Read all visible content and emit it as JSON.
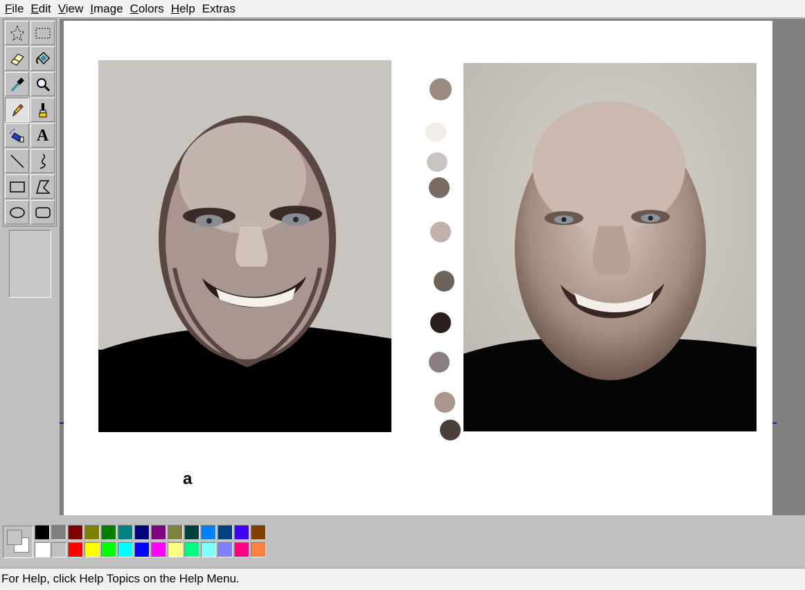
{
  "menu": {
    "items": [
      {
        "accel": "F",
        "rest": "ile"
      },
      {
        "accel": "E",
        "rest": "dit"
      },
      {
        "accel": "V",
        "rest": "iew"
      },
      {
        "accel": "I",
        "rest": "mage"
      },
      {
        "accel": "C",
        "rest": "olors"
      },
      {
        "accel": "H",
        "rest": "elp"
      },
      {
        "accel": "",
        "rest": "Extras"
      }
    ]
  },
  "tools": [
    {
      "name": "free-form-select",
      "icon": "star-select-icon"
    },
    {
      "name": "select",
      "icon": "rect-select-icon"
    },
    {
      "name": "eraser",
      "icon": "eraser-icon"
    },
    {
      "name": "fill",
      "icon": "paint-bucket-icon"
    },
    {
      "name": "pick-color",
      "icon": "eyedropper-icon"
    },
    {
      "name": "magnifier",
      "icon": "magnifier-icon"
    },
    {
      "name": "pencil",
      "icon": "pencil-icon",
      "active": true
    },
    {
      "name": "brush",
      "icon": "brush-icon"
    },
    {
      "name": "airbrush",
      "icon": "airbrush-icon"
    },
    {
      "name": "text",
      "icon": "text-icon"
    },
    {
      "name": "line",
      "icon": "line-icon"
    },
    {
      "name": "curve",
      "icon": "curve-icon"
    },
    {
      "name": "rectangle",
      "icon": "rectangle-icon"
    },
    {
      "name": "polygon",
      "icon": "polygon-icon"
    },
    {
      "name": "ellipse",
      "icon": "ellipse-icon"
    },
    {
      "name": "rounded-rectangle",
      "icon": "rounded-rectangle-icon"
    }
  ],
  "text_glyph": "A",
  "canvas": {
    "caption": "a",
    "swatch_dots": [
      "#9a8a80",
      "#f3ede8",
      "#c8c5c0",
      "#7a6a62",
      "#c4b0aa",
      "#6e625c",
      "#2a1e1c",
      "#8a7e84",
      "#a8968c",
      "#4a3e3a"
    ]
  },
  "colors": {
    "foreground": "#c8c5c0",
    "background": "#ffffff",
    "palette_top": [
      "#000000",
      "#808080",
      "#800000",
      "#808000",
      "#008000",
      "#008080",
      "#000080",
      "#800080",
      "#808040",
      "#004040",
      "#0080ff",
      "#004080",
      "#4000ff",
      "#804000"
    ],
    "palette_bottom": [
      "#ffffff",
      "#c0c0c0",
      "#ff0000",
      "#ffff00",
      "#00ff00",
      "#00ffff",
      "#0000ff",
      "#ff00ff",
      "#ffff80",
      "#00ff80",
      "#80ffff",
      "#8080ff",
      "#ff0080",
      "#ff8040"
    ]
  },
  "status": {
    "help_text": "For Help, click Help Topics on the Help Menu."
  }
}
